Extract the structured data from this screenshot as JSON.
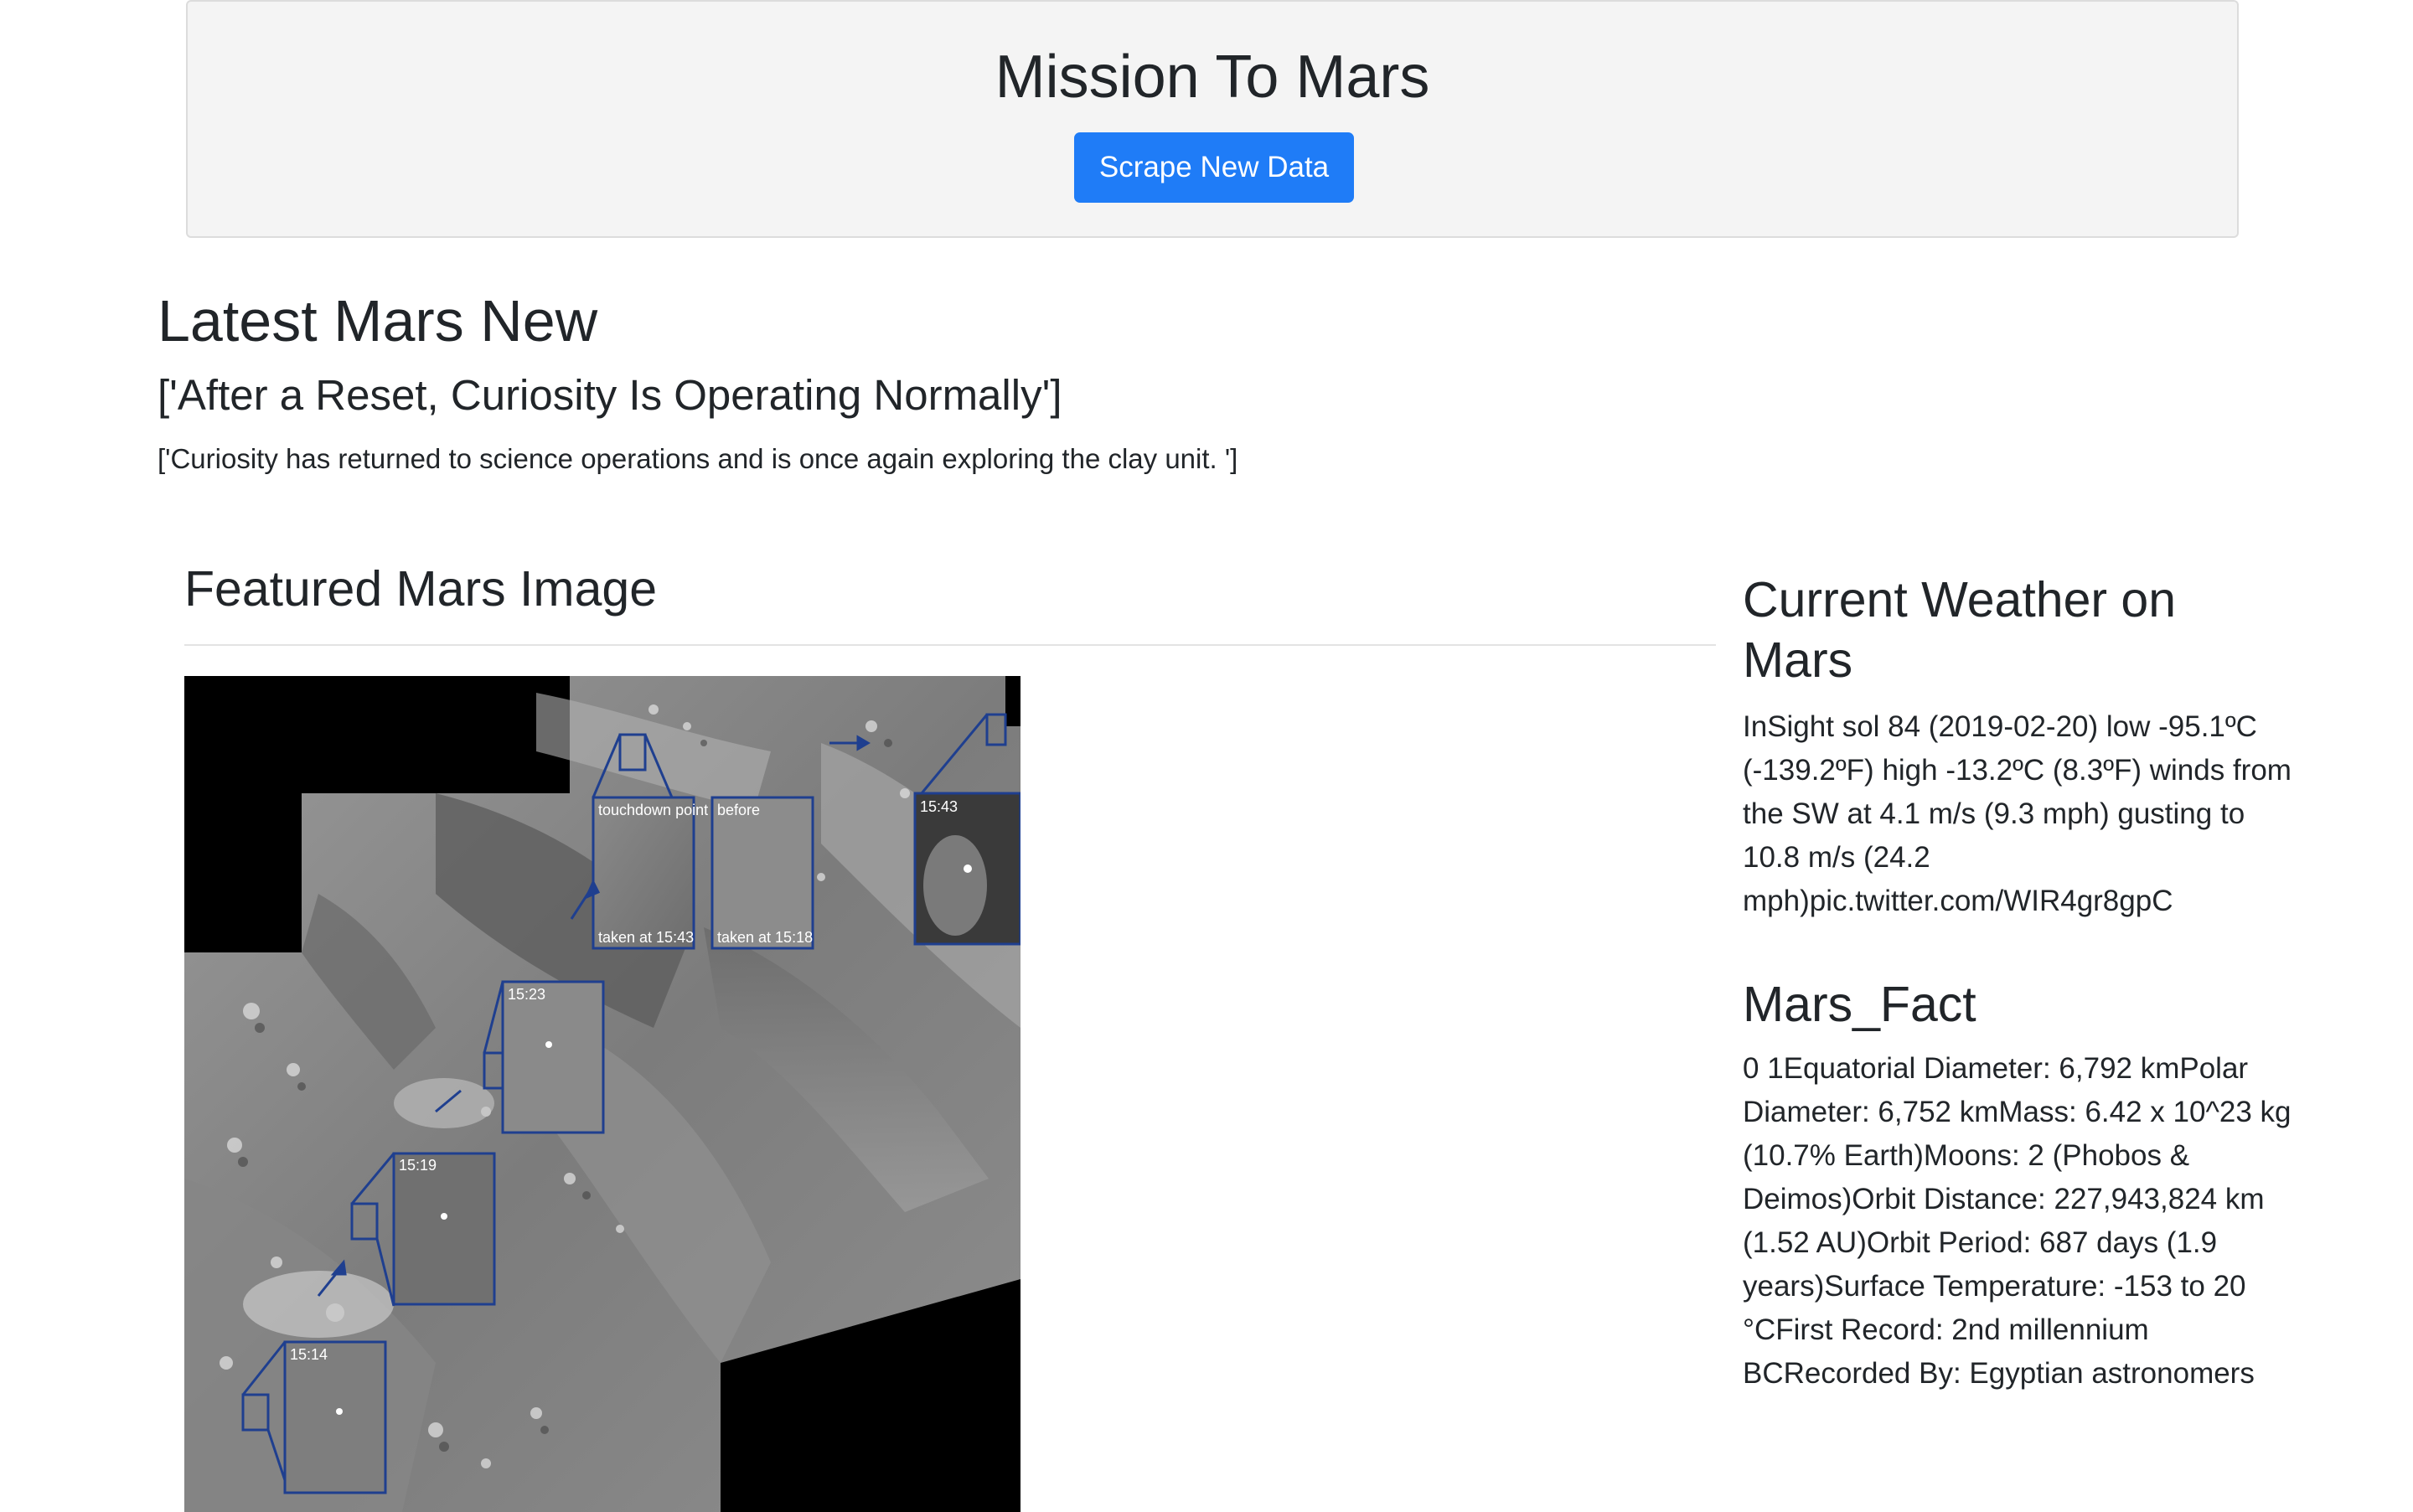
{
  "header": {
    "title": "Mission To Mars",
    "button_label": "Scrape New Data",
    "button_color": "#1f7cf7"
  },
  "news": {
    "heading": "Latest Mars New",
    "title": "['After a Reset, Curiosity Is Operating Normally']",
    "paragraph": "['Curiosity has returned to science operations and is once again exploring the clay unit. ']"
  },
  "featured": {
    "heading": "Featured Mars Image",
    "image_labels": {
      "touchdown": "touchdown point",
      "before": "before",
      "taken_1543": "taken at 15:43",
      "taken_1518": "taken at 15:18",
      "t1543": "15:43",
      "t1523": "15:23",
      "t1519": "15:19",
      "t1514": "15:14"
    }
  },
  "weather": {
    "heading": "Current Weather on Mars",
    "text": "InSight sol 84 (2019-02-20) low -95.1ºC (-139.2ºF) high -13.2ºC (8.3ºF) winds from the SW at 4.1 m/s (9.3 mph) gusting to 10.8 m/s (24.2 mph)pic.twitter.com/WIR4gr8gpC"
  },
  "facts": {
    "heading": "Mars_Fact",
    "text": "0 1Equatorial Diameter: 6,792 kmPolar Diameter: 6,752 kmMass: 6.42 x 10^23 kg (10.7% Earth)Moons: 2 (Phobos & Deimos)Orbit Distance: 227,943,824 km (1.52 AU)Orbit Period: 687 days (1.9 years)Surface Temperature: -153 to 20 °CFirst Record: 2nd millennium BCRecorded By: Egyptian astronomers"
  }
}
